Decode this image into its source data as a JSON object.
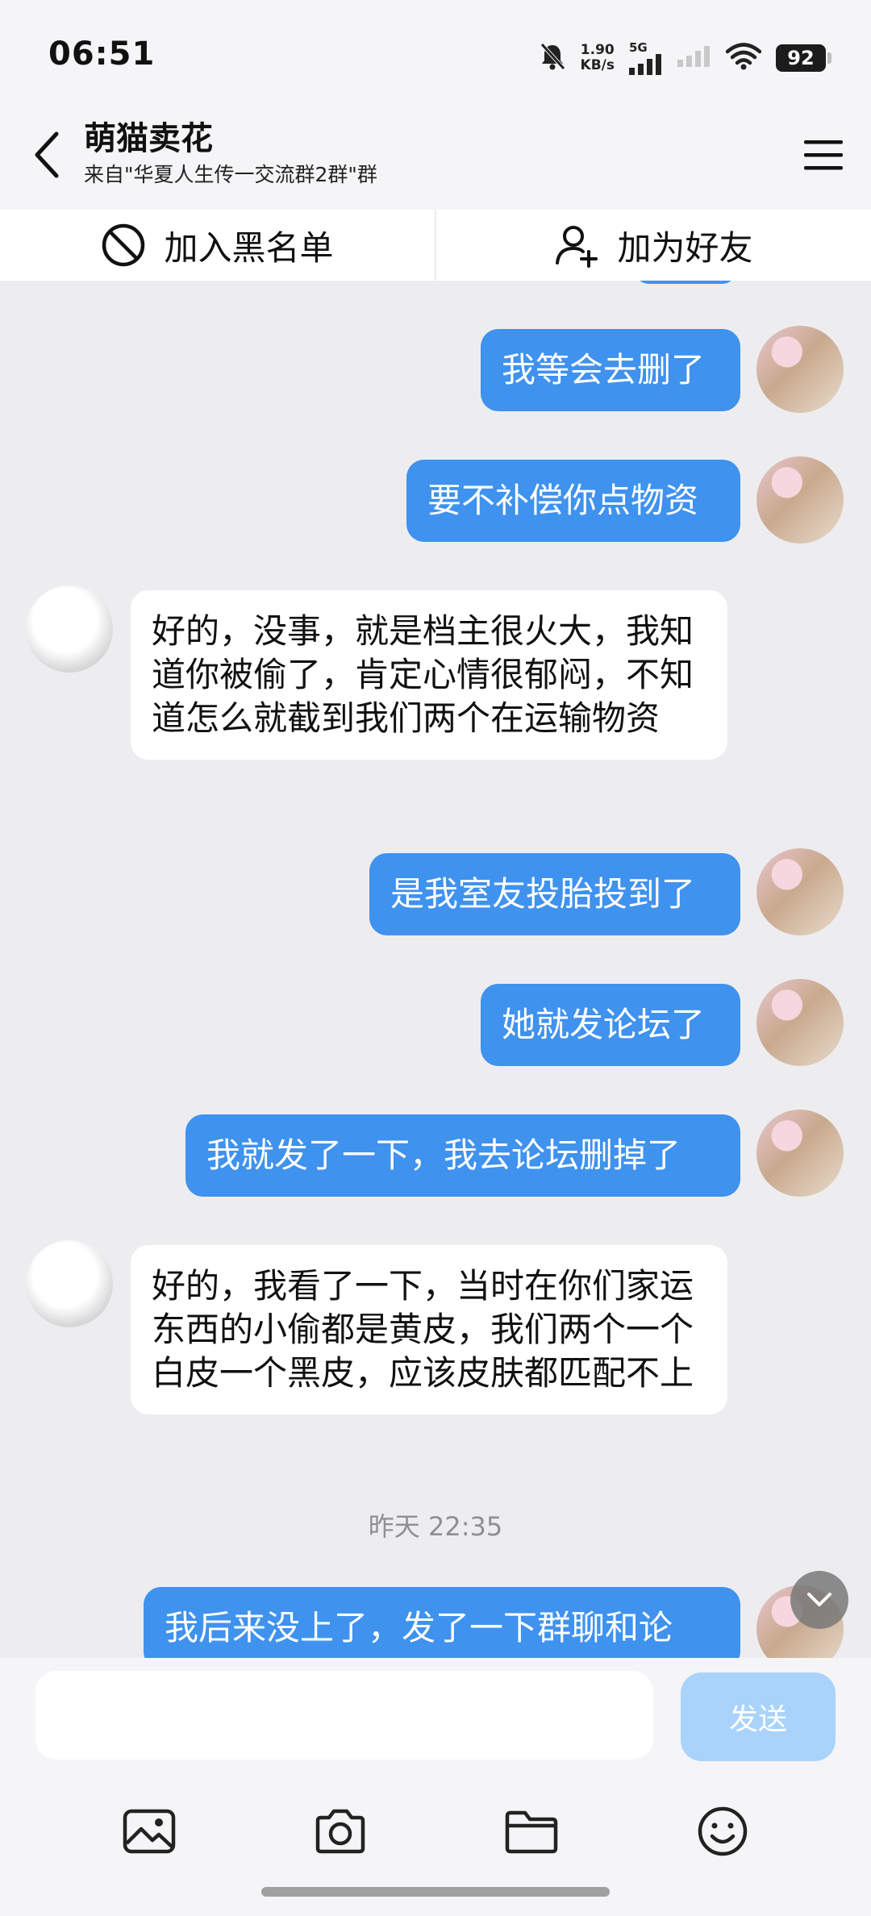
{
  "status_bar": {
    "time": "06:51",
    "net_speed_value": "1.90",
    "net_speed_unit": "KB/s",
    "signal_label": "5G",
    "battery": "92"
  },
  "header": {
    "title": "萌猫卖花",
    "subtitle": "来自\"华夏人生传一交流群2群\"群"
  },
  "actions": {
    "block_label": "加入黑名单",
    "add_friend_label": "加为好友"
  },
  "messages": [
    {
      "side": "out",
      "text": "我等会去删了"
    },
    {
      "side": "out",
      "text": "要不补偿你点物资"
    },
    {
      "side": "in",
      "text": "好的，没事，就是档主很火大，我知道你被偷了，肯定心情很郁闷，不知道怎么就截到我们两个在运输物资"
    },
    {
      "side": "out",
      "text": "是我室友投胎投到了"
    },
    {
      "side": "out",
      "text": "她就发论坛了"
    },
    {
      "side": "out",
      "text": "我就发了一下，我去论坛删掉了"
    },
    {
      "side": "in",
      "text": "好的，我看了一下，当时在你们家运东西的小偷都是黄皮，我们两个一个白皮一个黑皮，应该皮肤都匹配不上"
    },
    {
      "side": "out",
      "text": "我后来没上了，发了一下群聊和论"
    }
  ],
  "timestamp": "昨天 22:35",
  "input": {
    "placeholder": "",
    "value": "",
    "send_label": "发送"
  },
  "colors": {
    "bubble_out": "#3f92ee",
    "bubble_in": "#ffffff",
    "send_disabled": "#a9d3fb"
  }
}
